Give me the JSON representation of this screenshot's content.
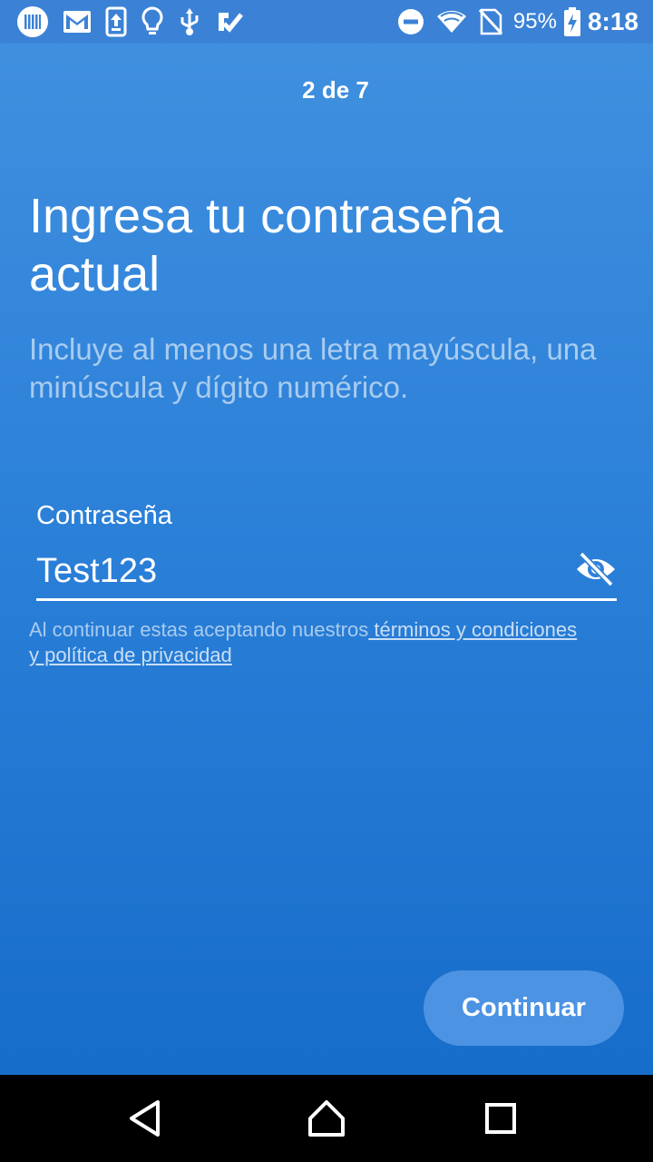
{
  "status_bar": {
    "icons_left": [
      "barcode-app-icon",
      "gmail-icon",
      "upload-app-icon",
      "bulb-icon",
      "usb-icon",
      "checkmark-app-icon"
    ],
    "icons_right": [
      "do-not-disturb-icon",
      "wifi-icon",
      "no-sim-icon",
      "battery-charging-icon"
    ],
    "battery": "95%",
    "time": "8:18"
  },
  "step_indicator": "2 de 7",
  "title": "Ingresa tu contraseña actual",
  "subtitle": "Incluye al menos una letra mayúscula, una minúscula y dígito numérico.",
  "password_field": {
    "label": "Contraseña",
    "value": "Test123",
    "toggle_icon": "eye-off-icon"
  },
  "terms": {
    "prefix": "Al continuar estas aceptando nuestros",
    "link": " términos y condiciones y política de privacidad"
  },
  "continue_label": "Continuar",
  "colors": {
    "background_top": "#4291e0",
    "background_bottom": "#136ac8",
    "button": "#4c93e3"
  },
  "nav_bar": [
    "back-icon",
    "home-icon",
    "recents-icon"
  ]
}
